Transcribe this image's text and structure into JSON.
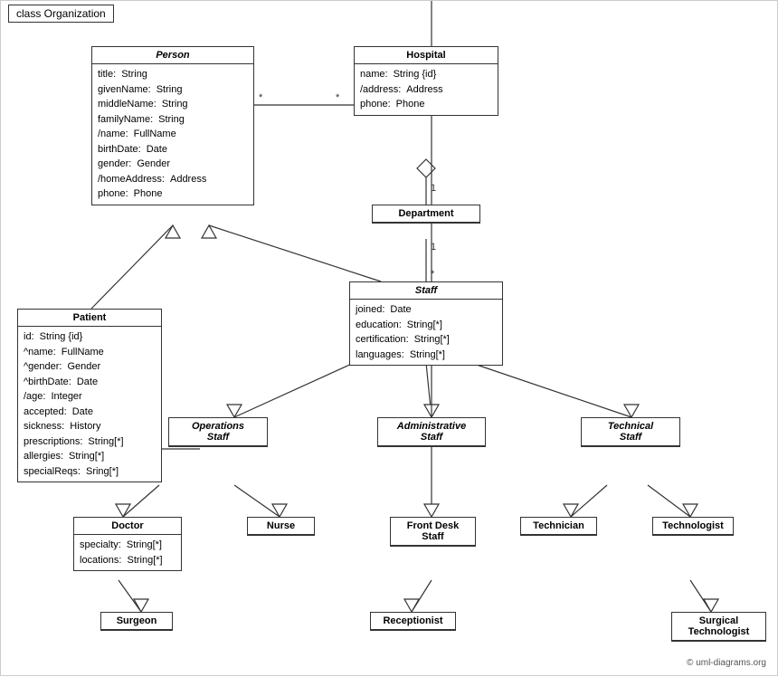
{
  "title": "class Organization",
  "classes": {
    "person": {
      "name": "Person",
      "italic": true,
      "attrs": [
        {
          "name": "title:",
          "type": "String"
        },
        {
          "name": "givenName:",
          "type": "String"
        },
        {
          "name": "middleName:",
          "type": "String"
        },
        {
          "name": "familyName:",
          "type": "String"
        },
        {
          "name": "/name:",
          "type": "FullName"
        },
        {
          "name": "birthDate:",
          "type": "Date"
        },
        {
          "name": "gender:",
          "type": "Gender"
        },
        {
          "name": "/homeAddress:",
          "type": "Address"
        },
        {
          "name": "phone:",
          "type": "Phone"
        }
      ]
    },
    "hospital": {
      "name": "Hospital",
      "italic": false,
      "attrs": [
        {
          "name": "name:",
          "type": "String {id}"
        },
        {
          "name": "/address:",
          "type": "Address"
        },
        {
          "name": "phone:",
          "type": "Phone"
        }
      ]
    },
    "patient": {
      "name": "Patient",
      "italic": false,
      "attrs": [
        {
          "name": "id:",
          "type": "String {id}"
        },
        {
          "name": "^name:",
          "type": "FullName"
        },
        {
          "name": "^gender:",
          "type": "Gender"
        },
        {
          "name": "^birthDate:",
          "type": "Date"
        },
        {
          "name": "/age:",
          "type": "Integer"
        },
        {
          "name": "accepted:",
          "type": "Date"
        },
        {
          "name": "sickness:",
          "type": "History"
        },
        {
          "name": "prescriptions:",
          "type": "String[*]"
        },
        {
          "name": "allergies:",
          "type": "String[*]"
        },
        {
          "name": "specialReqs:",
          "type": "Sring[*]"
        }
      ]
    },
    "department": {
      "name": "Department",
      "italic": false,
      "attrs": []
    },
    "staff": {
      "name": "Staff",
      "italic": true,
      "attrs": [
        {
          "name": "joined:",
          "type": "Date"
        },
        {
          "name": "education:",
          "type": "String[*]"
        },
        {
          "name": "certification:",
          "type": "String[*]"
        },
        {
          "name": "languages:",
          "type": "String[*]"
        }
      ]
    },
    "operations_staff": {
      "name": "Operations Staff",
      "italic": true,
      "attrs": []
    },
    "administrative_staff": {
      "name": "Administrative Staff",
      "italic": true,
      "attrs": []
    },
    "technical_staff": {
      "name": "Technical Staff",
      "italic": true,
      "attrs": []
    },
    "doctor": {
      "name": "Doctor",
      "italic": false,
      "attrs": [
        {
          "name": "specialty:",
          "type": "String[*]"
        },
        {
          "name": "locations:",
          "type": "String[*]"
        }
      ]
    },
    "nurse": {
      "name": "Nurse",
      "italic": false,
      "attrs": []
    },
    "front_desk_staff": {
      "name": "Front Desk Staff",
      "italic": false,
      "attrs": []
    },
    "technician": {
      "name": "Technician",
      "italic": false,
      "attrs": []
    },
    "technologist": {
      "name": "Technologist",
      "italic": false,
      "attrs": []
    },
    "surgeon": {
      "name": "Surgeon",
      "italic": false,
      "attrs": []
    },
    "receptionist": {
      "name": "Receptionist",
      "italic": false,
      "attrs": []
    },
    "surgical_technologist": {
      "name": "Surgical Technologist",
      "italic": false,
      "attrs": []
    }
  },
  "watermark": "© uml-diagrams.org"
}
